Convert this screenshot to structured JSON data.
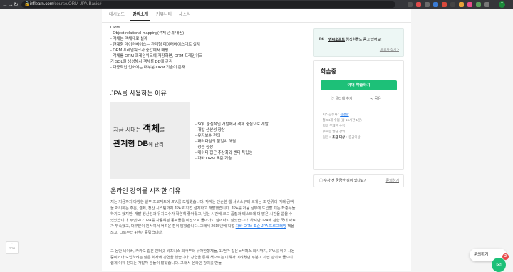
{
  "browser": {
    "url_host": "inflearn.com",
    "url_path": "/course/ORM-JPA-Basic#",
    "profile_initial": "T"
  },
  "tabs": [
    {
      "label": "대시보드"
    },
    {
      "label": "강의소개"
    },
    {
      "label": "커뮤니티"
    },
    {
      "label": "새소식"
    }
  ],
  "orm": {
    "heading": "ORM",
    "items": [
      "- Object-relational mapping(객체 관계 매핑)",
      "- 객체는 객체대로 설계",
      "- 관계형 데이터베이스는 관계형 데이터베이스대로 설계",
      "- ORM 프레임워크가 중간에서 매핑",
      "- 객체를 ORM 프레임워크에 저장하면, ORM 프레임워크",
      "가 SQL을 생성해서 객체를 DB에 관리",
      "- 대중적인 언어에는 대부분 ORM 기술이 존재"
    ]
  },
  "why": {
    "heading": "JPA를 사용하는 이유",
    "image_line1_pre": "지금 시대는 ",
    "image_line1_bold": "객체",
    "image_line1_post": "를",
    "image_line2_bold": "관계형 DB",
    "image_line2_post": "에 관리",
    "items": [
      "- SQL 중심적인 개발에서 객체 중심으로 개발",
      "- 개발 생산성 향상",
      "- 유지보수 편의",
      "- 패러다임의 불일치 해결",
      "- 성능 향상",
      "- 데이터 접근 추상화와 벤더 독립성",
      "- 자바 ORM 표준 기술"
    ]
  },
  "online": {
    "heading": "온라인 강의를 시작한 이유",
    "para1_a": "저는 지금까지 다양한 실무 프로젝트에 JPA를 도입했습니다. 작게는 단순한 웹 서비스부터 크게는 조 단위의 거래 금액을 처리하는 주문, 결제, 정산 시스템까지 JPA로 직접 설계하고 개발했습니다. JPA를 처음 실무에 도입할 때는 좌충우돌 하기도 했지만, 개발 생산성과 유지보수가 확연히 좋아졌고, 남는 시간에 코드 품질과 테스트에 더 많은 시간을 쏟을 수 있었습니다. 무엇보다 JPA를 사용해본 동료들은 이전으로 돌아가고 싶어하지 않았습니다. 하지만 JPA에 관한 국내 자료가 부족했고, 대부분이 원서여서 어려운 점이 많았습니다. 그래서 2015년에 직접 ",
    "para1_link": "자바 ORM 표준 JPA 프로그래밍",
    "para1_b": " 책을 쓰고, 그로부터 4년이 흘렀습니다.",
    "para2": "그 동안 네이버, 카카오 같은 인터넷 비즈니스 회사부터 우아한형제들, 11번가 같은 e커머스 회사까지, JPA를 이미 사용중이거나 도입하려는 많은 회사에 강연을 했습니다. 강연을 통해 책으로는 이해가 어려웠던 부분이 직접 강의로 들으니 쉽게 이해 된다는 개발자 분들이 많았습니다. 그래서 온라인 강의를 만들"
  },
  "ad": {
    "logo": "nc",
    "brand": "엔씨소프트",
    "text": " 임직원들도 듣고 있어요!",
    "link": "내 회사 찾기 >"
  },
  "card": {
    "title": "학습중",
    "primary_button": "이어 학습하기",
    "wishlist": "♡ 폴더에 추가",
    "share": "공유",
    "meta": [
      {
        "label": "· 지식공유자 : ",
        "value": "김영한"
      },
      {
        "label": "· 총 54개 수업 (총 16시간 1분)",
        "value": ""
      },
      {
        "label": "· 평생 무제한 수강",
        "value": ""
      },
      {
        "label": "· 수료증 발급 강의",
        "value": ""
      },
      {
        "label": "· 입문 > ",
        "value": "초급 대상",
        "suffix": " > 중급이상"
      }
    ]
  },
  "question": {
    "text": "수강 전 궁금한 점이 있나요?",
    "link": "문의하기"
  },
  "floating": {
    "top_label": "TOP",
    "chat_label": "문의하기",
    "chat_badge": "2"
  },
  "colors": {
    "accent": "#1dc078",
    "link": "#1a73e8",
    "ad_bg": "#edf7f5"
  }
}
